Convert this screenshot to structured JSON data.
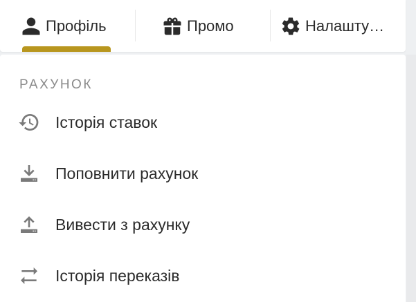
{
  "tabs": [
    {
      "label": "Профіль",
      "icon": "user-icon",
      "active": true
    },
    {
      "label": "Промо",
      "icon": "gift-icon",
      "active": false
    },
    {
      "label": "Налашту…",
      "icon": "gear-icon",
      "active": false
    }
  ],
  "accent_color": "#b8961e",
  "section": {
    "title": "РАХУНОК",
    "items": [
      {
        "label": "Історія ставок",
        "icon": "history-icon"
      },
      {
        "label": "Поповнити рахунок",
        "icon": "download-icon"
      },
      {
        "label": "Вивести з рахунку",
        "icon": "upload-icon"
      },
      {
        "label": "Історія переказів",
        "icon": "transfer-arrows-icon"
      }
    ]
  }
}
